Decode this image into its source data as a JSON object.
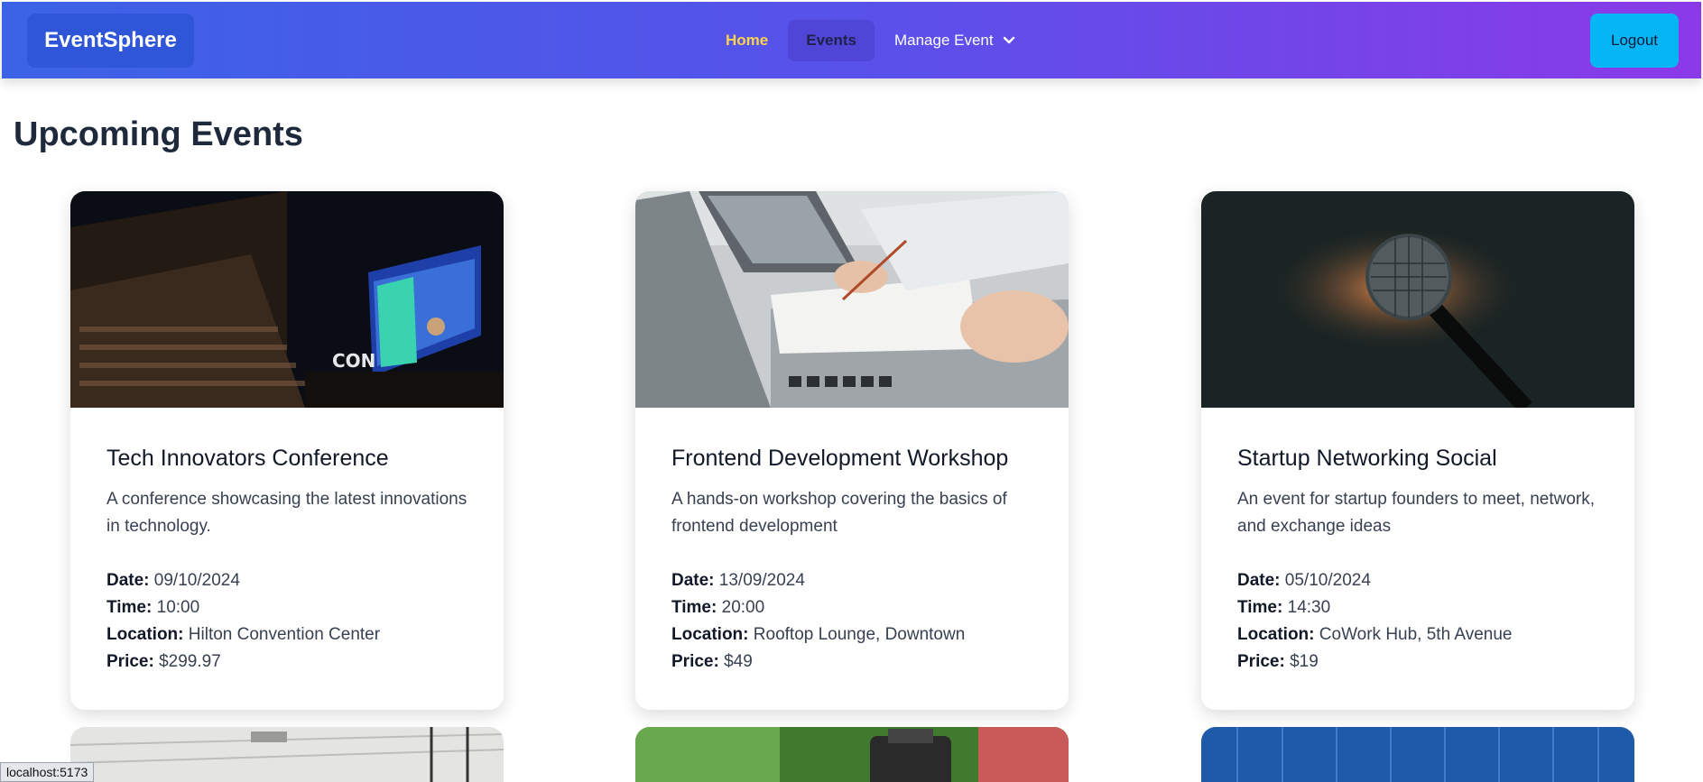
{
  "nav": {
    "brand": "EventSphere",
    "links": [
      {
        "label": "Home"
      },
      {
        "label": "Events"
      },
      {
        "label": "Manage Event"
      }
    ],
    "logout": "Logout"
  },
  "page": {
    "title": "Upcoming Events"
  },
  "labels": {
    "date": "Date:",
    "time": "Time:",
    "location": "Location:",
    "price": "Price:"
  },
  "events": [
    {
      "title": "Tech Innovators Conference",
      "description": "A conference showcasing the latest innovations in technology.",
      "date": "09/10/2024",
      "time": "10:00",
      "location": "Hilton Convention Center",
      "price": "$299.97"
    },
    {
      "title": "Frontend Development Workshop",
      "description": "A hands-on workshop covering the basics of frontend development",
      "date": "13/09/2024",
      "time": "20:00",
      "location": "Rooftop Lounge, Downtown",
      "price": "$49"
    },
    {
      "title": "Startup Networking Social",
      "description": "An event for startup founders to meet, network, and exchange ideas",
      "date": "05/10/2024",
      "time": "14:30",
      "location": "CoWork Hub, 5th Avenue",
      "price": "$19"
    }
  ],
  "status_bar": "localhost:5173"
}
